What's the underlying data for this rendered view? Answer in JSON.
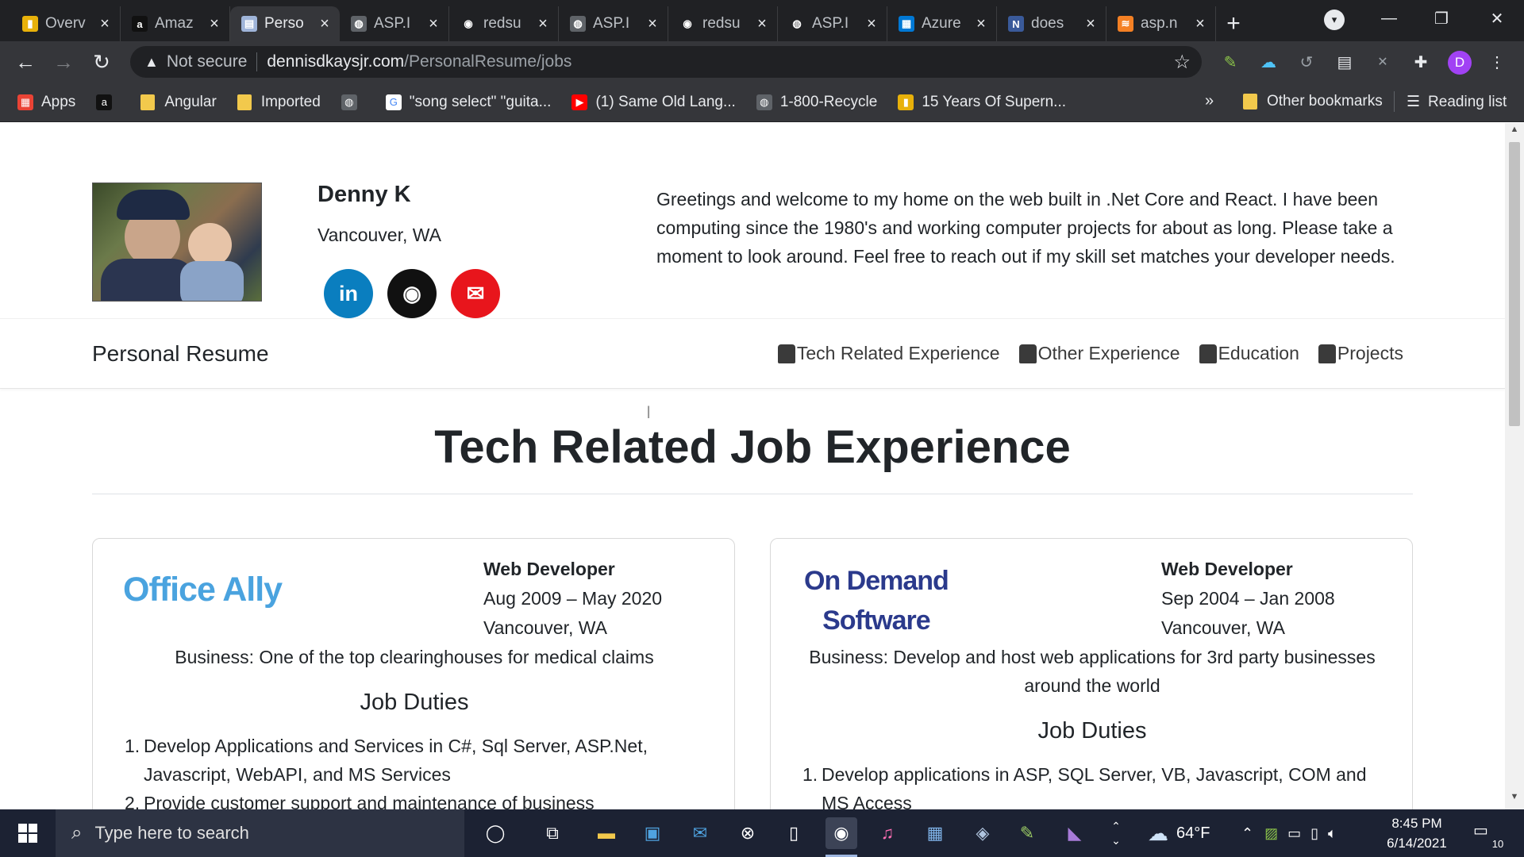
{
  "browser": {
    "tabs": [
      {
        "label": "Overv",
        "favicon_color": "#e8b10a",
        "favicon_glyph": "▮"
      },
      {
        "label": "Amaz",
        "favicon_color": "#111111",
        "favicon_glyph": "a"
      },
      {
        "label": "Perso",
        "favicon_color": "#9fb4d9",
        "favicon_glyph": "▤",
        "active": true
      },
      {
        "label": "ASP.I",
        "favicon_color": "#5f6368",
        "favicon_glyph": "◍"
      },
      {
        "label": "redsu",
        "favicon_color": "#202124",
        "favicon_glyph": "◉"
      },
      {
        "label": "ASP.I",
        "favicon_color": "#5f6368",
        "favicon_glyph": "◍"
      },
      {
        "label": "redsu",
        "favicon_color": "#202124",
        "favicon_glyph": "◉"
      },
      {
        "label": "ASP.I",
        "favicon_color": "#202124",
        "favicon_glyph": "◍"
      },
      {
        "label": "Azure",
        "favicon_color": "#0078d4",
        "favicon_glyph": "▦"
      },
      {
        "label": "does",
        "favicon_color": "#3a5a9a",
        "favicon_glyph": "N"
      },
      {
        "label": "asp.n",
        "favicon_color": "#f48024",
        "favicon_glyph": "≋"
      }
    ],
    "new_tab": "+",
    "url": {
      "security": "Not secure",
      "host": "dennisdkaysjr.com",
      "path": "/PersonalResume/jobs"
    },
    "profile_initial": "D",
    "bookmarks": [
      {
        "label": "Apps",
        "type": "apps"
      },
      {
        "label": "",
        "type": "amazon"
      },
      {
        "label": "Angular",
        "type": "folder"
      },
      {
        "label": "Imported",
        "type": "folder"
      },
      {
        "label": "",
        "type": "globe"
      },
      {
        "label": "\"song select\" \"guita...",
        "type": "google"
      },
      {
        "label": "(1) Same Old Lang...",
        "type": "youtube"
      },
      {
        "label": "1-800-Recycle",
        "type": "globe"
      },
      {
        "label": "15 Years Of Supern...",
        "type": "flag"
      }
    ],
    "bookmarks_more": "»",
    "other_bookmarks": "Other bookmarks",
    "reading_list": "Reading list"
  },
  "header": {
    "name": "Denny K",
    "location": "Vancouver, WA",
    "social": [
      {
        "network": "linkedin",
        "glyph": "in",
        "color": "#0a7ebf"
      },
      {
        "network": "github",
        "glyph": "◉",
        "color": "#111111"
      },
      {
        "network": "email",
        "glyph": "✉",
        "color": "#e8151c"
      }
    ],
    "intro": "Greetings and welcome to my home on the web built in .Net Core and React. I have been computing since the 1980's and working computer projects for about as long. Please take a moment to look around. Feel free to reach out if my skill set matches your developer needs."
  },
  "nav": {
    "brand": "Personal Resume",
    "links": [
      {
        "label": "Tech Related Experience",
        "icon": "user-tie-icon"
      },
      {
        "label": "Other Experience",
        "icon": "user-tie-icon"
      },
      {
        "label": "Education",
        "icon": "school-icon"
      },
      {
        "label": "Projects",
        "icon": "briefcase-icon"
      }
    ]
  },
  "main": {
    "title": "Tech Related Job Experience",
    "jobs": [
      {
        "company_logo": "Office Ally",
        "role": "Web Developer",
        "dates": "Aug 2009 – May 2020",
        "location": "Vancouver, WA",
        "business": "Business: One of the top clearinghouses for medical claims",
        "duties_title": "Job Duties",
        "duties": [
          "Develop Applications and Services in C#, Sql Server, ASP.Net, Javascript, WebAPI, and MS Services",
          "Provide customer support and maintenance of business"
        ]
      },
      {
        "company_logo_line1": "On Demand",
        "company_logo_line2": "Software",
        "role": "Web Developer",
        "dates": "Sep 2004 – Jan 2008",
        "location": "Vancouver, WA",
        "business": "Business: Develop and host web applications for 3rd party businesses around the world",
        "duties_title": "Job Duties",
        "duties": [
          "Develop applications in ASP, SQL Server, VB, Javascript, COM and MS Access"
        ]
      }
    ]
  },
  "taskbar": {
    "search_placeholder": "Type here to search",
    "weather": "64°F",
    "time": "8:45 PM",
    "date": "6/14/2021",
    "notification_count": "10"
  }
}
